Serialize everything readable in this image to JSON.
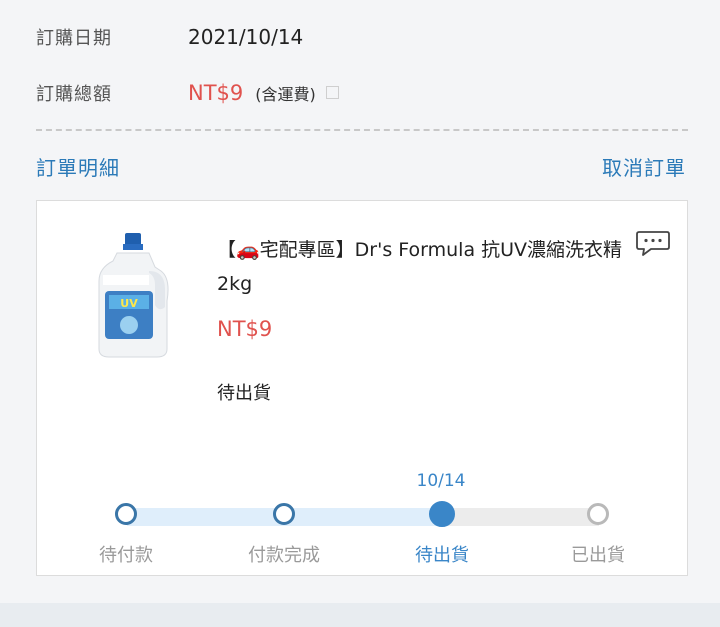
{
  "order": {
    "date_label": "訂購日期",
    "date_value": "2021/10/14",
    "total_label": "訂購總額",
    "total_value": "NT$9",
    "shipping_note": "(含運費)"
  },
  "links": {
    "details": "訂單明細",
    "cancel": "取消訂單"
  },
  "product": {
    "title": "【🚗宅配專區】Dr's Formula 抗UV濃縮洗衣精2kg",
    "price": "NT$9",
    "status": "待出貨",
    "chat_icon": "chat-bubble-icon"
  },
  "progress": {
    "current_date": "10/14",
    "steps": [
      {
        "label": "待付款",
        "state": "done"
      },
      {
        "label": "付款完成",
        "state": "done"
      },
      {
        "label": "待出貨",
        "state": "active"
      },
      {
        "label": "已出貨",
        "state": "pending"
      }
    ]
  },
  "colors": {
    "price": "#e0524e",
    "link": "#2b7ab8",
    "progress_active": "#3a86c8"
  }
}
